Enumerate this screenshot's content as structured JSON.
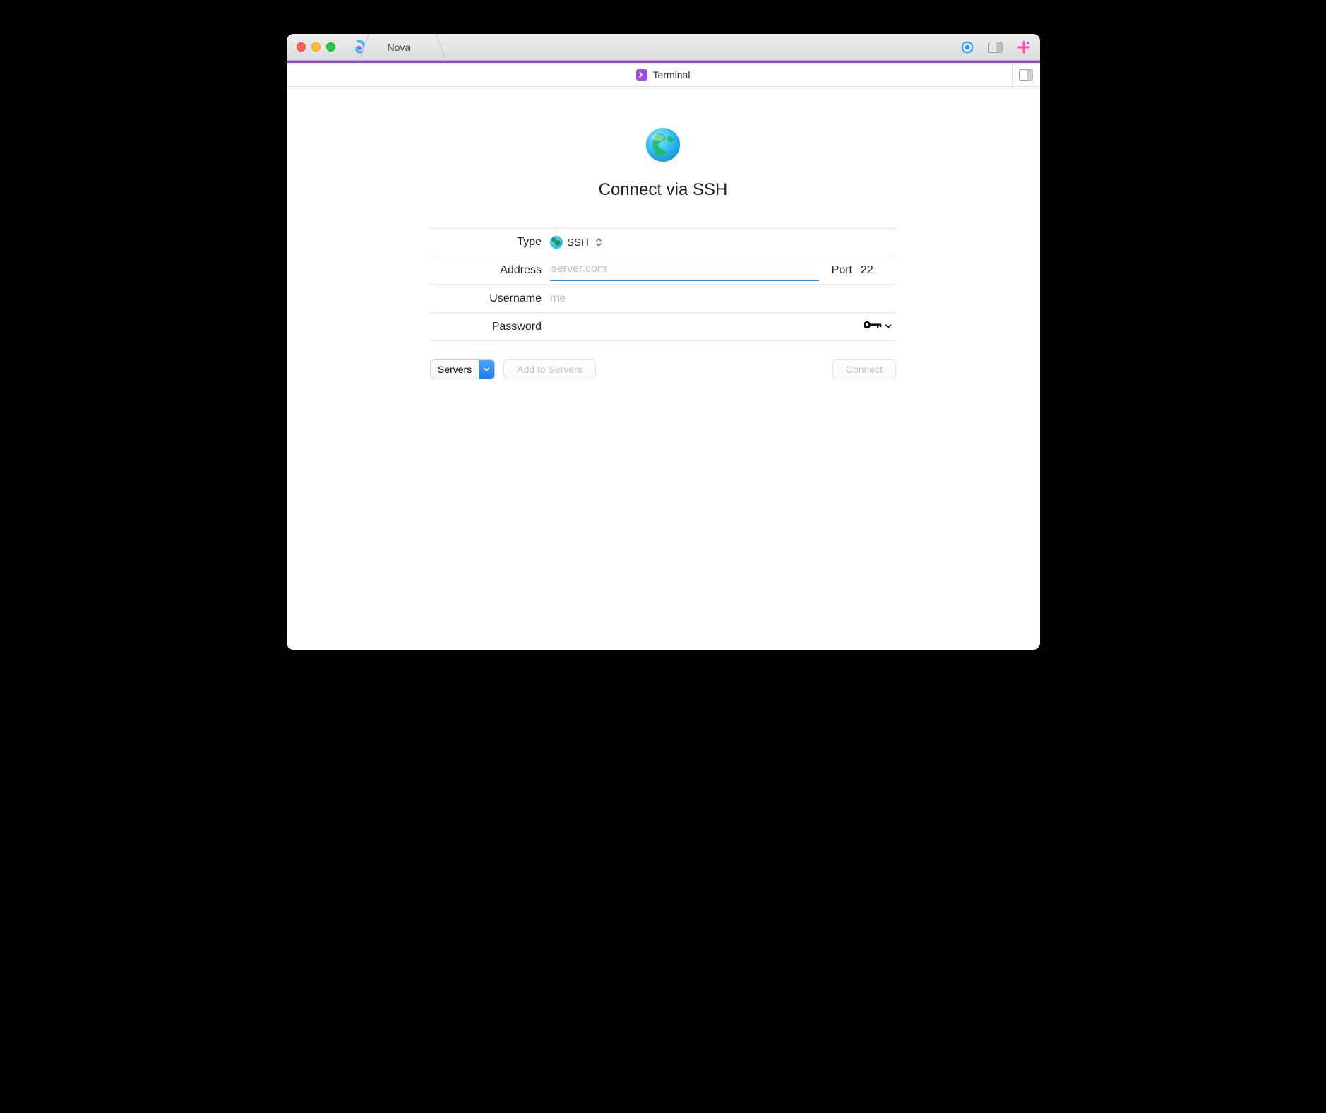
{
  "appName": "Nova",
  "tab": {
    "label": "Terminal"
  },
  "heading": "Connect via SSH",
  "form": {
    "typeLabel": "Type",
    "typeValue": "SSH",
    "addressLabel": "Address",
    "addressPlaceholder": "server.com",
    "addressValue": "",
    "portLabel": "Port",
    "portValue": "22",
    "usernameLabel": "Username",
    "usernamePlaceholder": "me",
    "usernameValue": "",
    "passwordLabel": "Password",
    "passwordValue": ""
  },
  "footer": {
    "serversLabel": "Servers",
    "addToServersLabel": "Add to Servers",
    "connectLabel": "Connect"
  }
}
